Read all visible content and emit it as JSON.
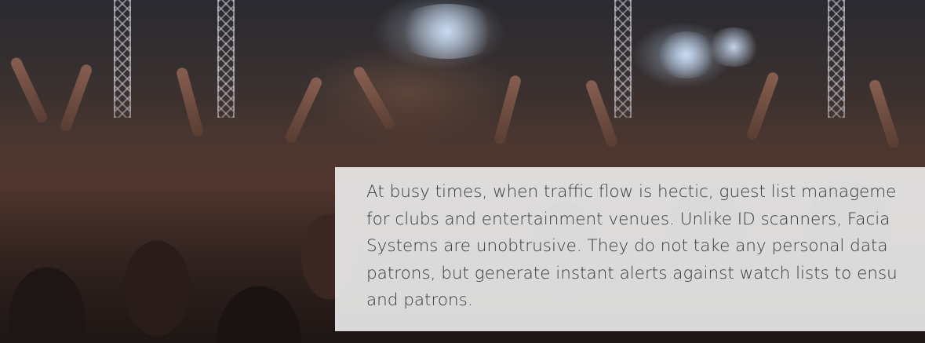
{
  "hero": {
    "image": "concert-crowd-photo",
    "overlay_text": "At busy times, when traffic flow is hectic, guest list management for clubs and entertainment venues. Unlike ID scanners, Facial Systems are unobtrusive. They do not take any personal data patrons, but generate instant alerts against watch lists to ensu and patrons.",
    "overlay_lines": [
      "At busy times, when traffic flow is hectic, guest list manageme",
      "for clubs and entertainment venues. Unlike ID scanners, Facia",
      "Systems are unobtrusive. They do not take any personal data",
      "patrons, but generate instant alerts against watch lists to ensu",
      "and patrons."
    ]
  },
  "colors": {
    "panel_background": "#e8e8e8",
    "text": "#3a3a3a"
  }
}
